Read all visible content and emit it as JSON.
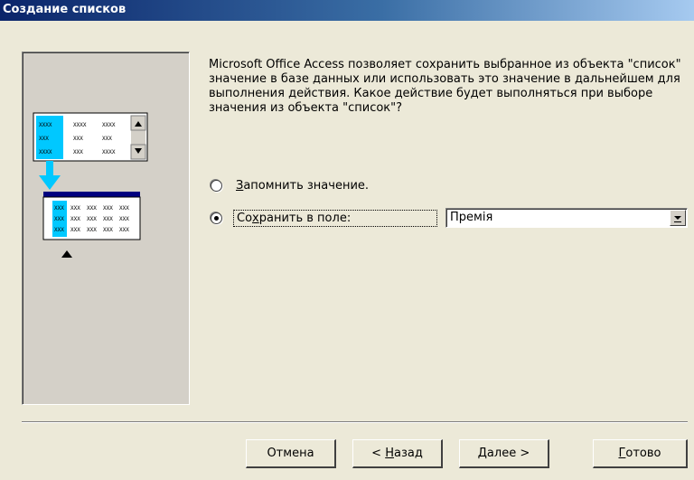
{
  "window": {
    "title": "Создание списков"
  },
  "wizard": {
    "description": "Microsoft Office Access позволяет сохранить выбранное из объекта \"список\" значение в базе данных или использовать это значение в дальнейшем для выполнения действия.  Какое действие будет выполняться при выборе значения из объекта \"список\"?",
    "option_remember": {
      "pre": "",
      "key": "З",
      "post": "апомнить значение.",
      "selected": false
    },
    "option_store": {
      "pre": "Со",
      "key": "х",
      "post": "ранить в поле:",
      "selected": true
    },
    "field_combo": {
      "value": "Премія"
    }
  },
  "illustration": {
    "cell_text": "XXXX",
    "small_text": "XXX"
  },
  "buttons": {
    "cancel": {
      "label": "Отмена"
    },
    "back": {
      "pre": "< ",
      "key": "Н",
      "post": "азад"
    },
    "next": {
      "pre": "",
      "key": "Д",
      "post": "алее >"
    },
    "finish": {
      "pre": "",
      "key": "Г",
      "post": "отово"
    }
  }
}
